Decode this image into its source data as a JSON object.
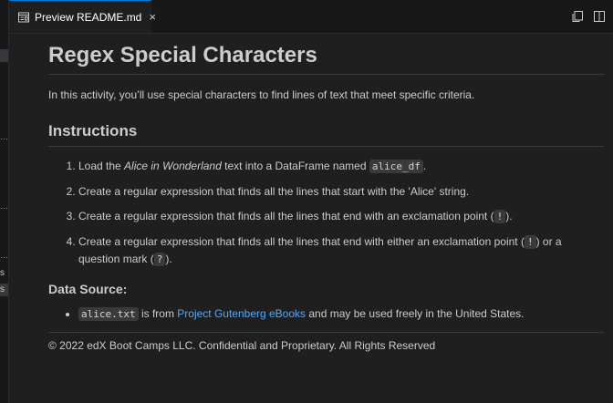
{
  "tab": {
    "label": "Preview README.md",
    "close_glyph": "×",
    "icon": "preview-icon"
  },
  "actions": {
    "icons": [
      "open-source-icon",
      "more-actions-icon"
    ]
  },
  "left_strip": {
    "fragments": [
      "s",
      "s"
    ]
  },
  "doc": {
    "title": "Regex Special Characters",
    "intro": "In this activity, you’ll use special characters to find lines of text that meet specific criteria.",
    "instructions_heading": "Instructions",
    "steps": [
      {
        "pre": "Load the ",
        "em": "Alice in Wonderland",
        "mid": " text into a DataFrame named ",
        "code": "alice_df",
        "post": "."
      },
      {
        "text": "Create a regular expression that finds all the lines that start with the 'Alice' string."
      },
      {
        "pre": "Create a regular expression that finds all the lines that end with an exclamation point (",
        "code": "!",
        "post": ")."
      },
      {
        "pre": "Create a regular expression that finds all the lines that end with either an exclamation point (",
        "code1": "!",
        "mid": ") or a question mark (",
        "code2": "?",
        "post": ")."
      }
    ],
    "source_heading": "Data Source:",
    "source": {
      "code": "alice.txt",
      "pre": " is from ",
      "link": "Project Gutenberg eBooks",
      "post": " and may be used freely in the United States."
    },
    "copyright": "© 2022 edX Boot Camps LLC. Confidential and Proprietary. All Rights Reserved"
  },
  "colors": {
    "accent": "#0078d4",
    "link": "#4daafc",
    "background": "#1f1f1f",
    "text": "#cccccc"
  }
}
